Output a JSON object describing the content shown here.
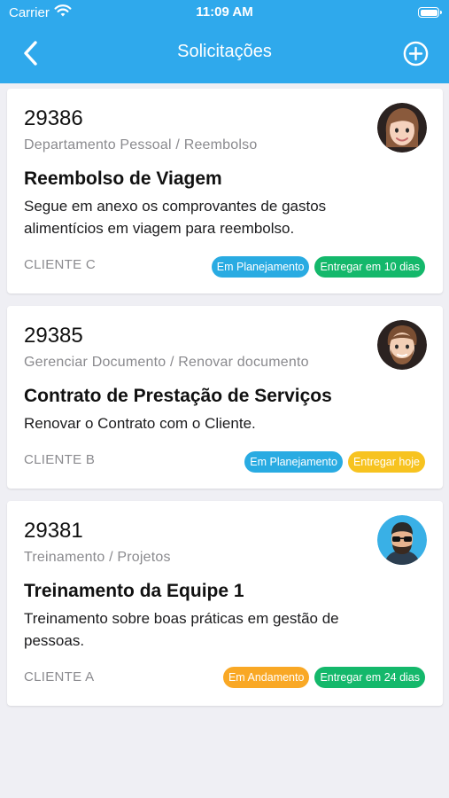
{
  "status_bar": {
    "carrier": "Carrier",
    "time": "11:09 AM"
  },
  "nav": {
    "title": "Solicitações"
  },
  "colors": {
    "header": "#2fa9ec",
    "planning": "#29abe2",
    "green": "#14b86b",
    "orange": "#f9a825",
    "yellow": "#f7c320"
  },
  "cards": [
    {
      "number": "29386",
      "category": "Departamento Pessoal / Reembolso",
      "title": "Reembolso de Viagem",
      "description": "Segue em anexo os comprovantes de gastos alimentícios em viagem para reembolso.",
      "client": "CLIENTE C",
      "avatar": "woman-memoji-avatar",
      "badges": [
        {
          "label": "Em Planejamento",
          "color": "#29abe2"
        },
        {
          "label": "Entregar em 10 dias",
          "color": "#14b86b"
        }
      ]
    },
    {
      "number": "29385",
      "category": "Gerenciar Documento / Renovar documento",
      "title": "Contrato de Prestação de Serviços",
      "description": "Renovar o Contrato com o Cliente.",
      "client": "CLIENTE B",
      "avatar": "bearded-man-memoji-avatar",
      "badges": [
        {
          "label": "Em Planejamento",
          "color": "#29abe2"
        },
        {
          "label": "Entregar hoje",
          "color": "#f7c320"
        }
      ]
    },
    {
      "number": "29381",
      "category": "Treinamento / Projetos",
      "title": "Treinamento da Equipe 1",
      "description": "Treinamento sobre boas práticas em gestão de pessoas.",
      "client": "CLIENTE A",
      "avatar": "man-sunglasses-avatar",
      "badges": [
        {
          "label": "Em Andamento",
          "color": "#f9a825"
        },
        {
          "label": "Entregar em 24 dias",
          "color": "#14b86b"
        }
      ]
    }
  ]
}
